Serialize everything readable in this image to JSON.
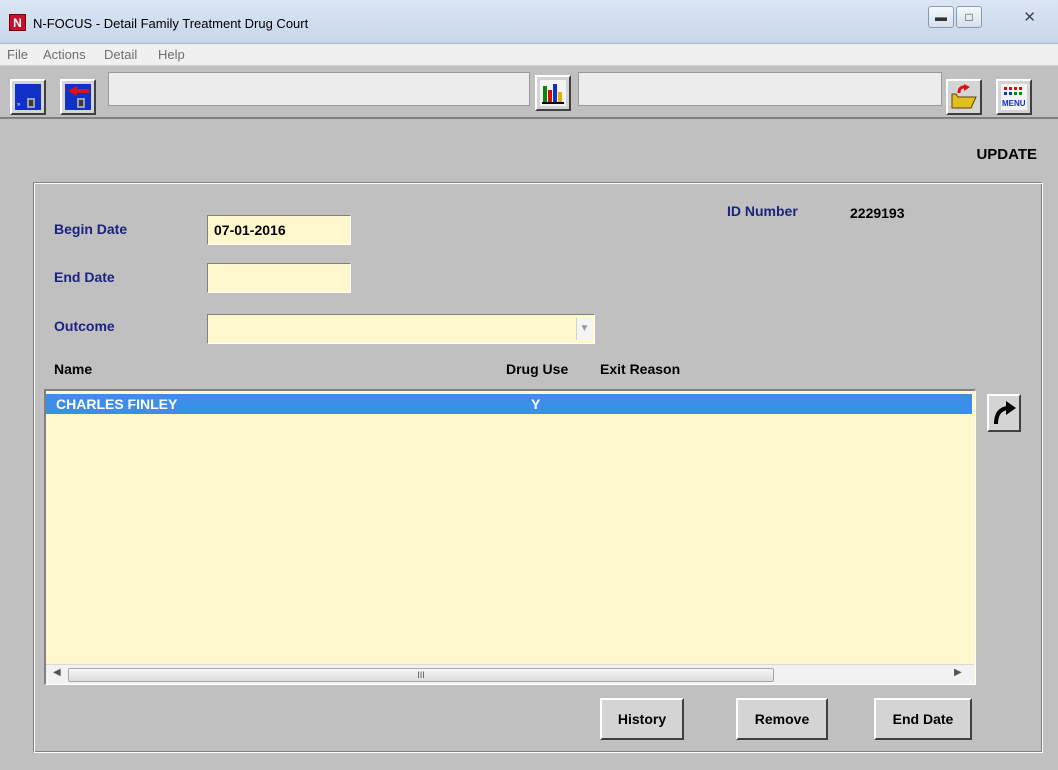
{
  "window": {
    "title": "N-FOCUS - Detail Family Treatment Drug Court",
    "app_icon_letter": "N"
  },
  "menu": [
    "File",
    "Actions",
    "Detail",
    "Help"
  ],
  "toolbar": {
    "icons": [
      "save-exit-icon",
      "back-exit-icon",
      "bar-chart-icon",
      "open-folder-icon",
      "menu-icon"
    ],
    "menu_icon_text": "MENU"
  },
  "mode_label": "UPDATE",
  "form": {
    "begin_date_label": "Begin Date",
    "begin_date_value": "07-01-2016",
    "end_date_label": "End Date",
    "end_date_value": "",
    "outcome_label": "Outcome",
    "outcome_value": "",
    "id_number_label": "ID Number",
    "id_number_value": "2229193"
  },
  "list": {
    "columns": [
      "Name",
      "Drug Use",
      "Exit Reason"
    ],
    "rows": [
      {
        "name": "CHARLES FINLEY",
        "drug_use": "Y",
        "exit_reason": ""
      }
    ]
  },
  "buttons": {
    "history": "History",
    "remove": "Remove",
    "end_date": "End Date"
  },
  "colors": {
    "selection": "#3d8ee8",
    "field_bg": "#fff8cc",
    "label_blue": "#1a237e"
  }
}
